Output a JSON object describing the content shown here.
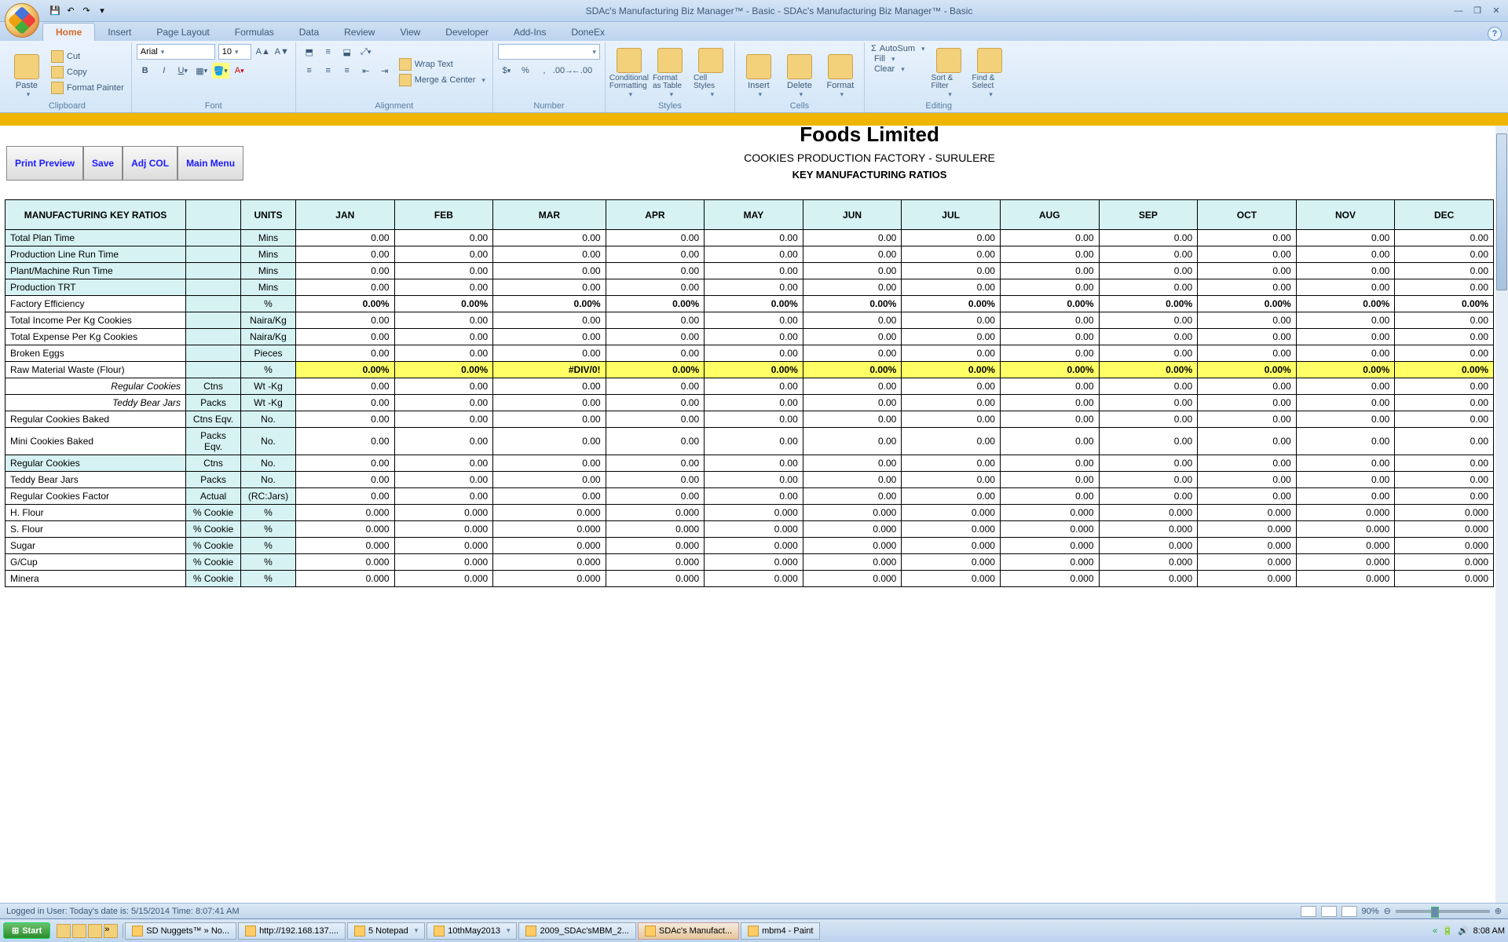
{
  "title": "SDAc's Manufacturing Biz Manager™ - Basic - SDAc's Manufacturing Biz Manager™ - Basic",
  "ribbon_tabs": [
    "Home",
    "Insert",
    "Page Layout",
    "Formulas",
    "Data",
    "Review",
    "View",
    "Developer",
    "Add-Ins",
    "DoneEx"
  ],
  "clipboard": {
    "paste": "Paste",
    "cut": "Cut",
    "copy": "Copy",
    "fp": "Format Painter",
    "label": "Clipboard"
  },
  "font": {
    "name": "Arial",
    "size": "10",
    "label": "Font"
  },
  "alignment": {
    "wrap": "Wrap Text",
    "merge": "Merge & Center",
    "label": "Alignment"
  },
  "number": {
    "label": "Number"
  },
  "styles": {
    "cond": "Conditional Formatting",
    "fat": "Format as Table",
    "cells": "Cell Styles",
    "label": "Styles"
  },
  "cells": {
    "insert": "Insert",
    "delete": "Delete",
    "format": "Format",
    "label": "Cells"
  },
  "editing": {
    "sum": "AutoSum",
    "fill": "Fill",
    "clear": "Clear",
    "sort": "Sort & Filter",
    "find": "Find & Select",
    "label": "Editing"
  },
  "doc_btns": [
    "Print Preview",
    "Save",
    "Adj COL",
    "Main Menu"
  ],
  "company": "Foods Limited",
  "factory": "COOKIES PRODUCTION FACTORY - SURULERE",
  "report": "KEY MANUFACTURING RATIOS",
  "headers": [
    "MANUFACTURING KEY RATIOS",
    "",
    "UNITS",
    "JAN",
    "FEB",
    "MAR",
    "APR",
    "MAY",
    "JUN",
    "JUL",
    "AUG",
    "SEP",
    "OCT",
    "NOV",
    "DEC"
  ],
  "rows": [
    {
      "label": "Total Plan Time",
      "c2": "",
      "u": "Mins",
      "vals": [
        "0.00",
        "0.00",
        "0.00",
        "0.00",
        "0.00",
        "0.00",
        "0.00",
        "0.00",
        "0.00",
        "0.00",
        "0.00",
        "0.00"
      ],
      "cls": "lbl"
    },
    {
      "label": "Production Line Run Time",
      "c2": "",
      "u": "Mins",
      "vals": [
        "0.00",
        "0.00",
        "0.00",
        "0.00",
        "0.00",
        "0.00",
        "0.00",
        "0.00",
        "0.00",
        "0.00",
        "0.00",
        "0.00"
      ],
      "cls": "lbl"
    },
    {
      "label": "Plant/Machine Run Time",
      "c2": "",
      "u": "Mins",
      "vals": [
        "0.00",
        "0.00",
        "0.00",
        "0.00",
        "0.00",
        "0.00",
        "0.00",
        "0.00",
        "0.00",
        "0.00",
        "0.00",
        "0.00"
      ],
      "cls": "lbl"
    },
    {
      "label": "Production TRT",
      "c2": "",
      "u": "Mins",
      "vals": [
        "0.00",
        "0.00",
        "0.00",
        "0.00",
        "0.00",
        "0.00",
        "0.00",
        "0.00",
        "0.00",
        "0.00",
        "0.00",
        "0.00"
      ],
      "cls": "lbl"
    },
    {
      "label": "Factory Efficiency",
      "c2": "",
      "u": "%",
      "vals": [
        "0.00%",
        "0.00%",
        "0.00%",
        "0.00%",
        "0.00%",
        "0.00%",
        "0.00%",
        "0.00%",
        "0.00%",
        "0.00%",
        "0.00%",
        "0.00%"
      ],
      "cls": "lbl-plain",
      "rowcls": "bold"
    },
    {
      "label": "Total Income Per Kg Cookies",
      "c2": "",
      "u": "Naira/Kg",
      "vals": [
        "0.00",
        "0.00",
        "0.00",
        "0.00",
        "0.00",
        "0.00",
        "0.00",
        "0.00",
        "0.00",
        "0.00",
        "0.00",
        "0.00"
      ],
      "cls": "lbl-plain"
    },
    {
      "label": "Total Expense Per Kg Cookies",
      "c2": "",
      "u": "Naira/Kg",
      "vals": [
        "0.00",
        "0.00",
        "0.00",
        "0.00",
        "0.00",
        "0.00",
        "0.00",
        "0.00",
        "0.00",
        "0.00",
        "0.00",
        "0.00"
      ],
      "cls": "lbl-plain"
    },
    {
      "label": "Broken Eggs",
      "c2": "",
      "u": "Pieces",
      "vals": [
        "0.00",
        "0.00",
        "0.00",
        "0.00",
        "0.00",
        "0.00",
        "0.00",
        "0.00",
        "0.00",
        "0.00",
        "0.00",
        "0.00"
      ],
      "cls": "lbl-plain"
    },
    {
      "label": "Raw Material Waste (Flour)",
      "c2": "",
      "u": "%",
      "vals": [
        "0.00%",
        "0.00%",
        "#DIV/0!",
        "0.00%",
        "0.00%",
        "0.00%",
        "0.00%",
        "0.00%",
        "0.00%",
        "0.00%",
        "0.00%",
        "0.00%"
      ],
      "cls": "lbl-plain",
      "rowcls": "yellow"
    },
    {
      "label": "Regular Cookies",
      "c2": "Ctns",
      "u": "Wt -Kg",
      "vals": [
        "0.00",
        "0.00",
        "0.00",
        "0.00",
        "0.00",
        "0.00",
        "0.00",
        "0.00",
        "0.00",
        "0.00",
        "0.00",
        "0.00"
      ],
      "cls": "lbl-right"
    },
    {
      "label": "Teddy Bear Jars",
      "c2": "Packs",
      "u": "Wt -Kg",
      "vals": [
        "0.00",
        "0.00",
        "0.00",
        "0.00",
        "0.00",
        "0.00",
        "0.00",
        "0.00",
        "0.00",
        "0.00",
        "0.00",
        "0.00"
      ],
      "cls": "lbl-right"
    },
    {
      "label": "Regular Cookies Baked",
      "c2": "Ctns Eqv.",
      "u": "No.",
      "vals": [
        "0.00",
        "0.00",
        "0.00",
        "0.00",
        "0.00",
        "0.00",
        "0.00",
        "0.00",
        "0.00",
        "0.00",
        "0.00",
        "0.00"
      ],
      "cls": "lbl-plain"
    },
    {
      "label": "Mini Cookies Baked",
      "c2": "Packs Eqv.",
      "u": "No.",
      "vals": [
        "0.00",
        "0.00",
        "0.00",
        "0.00",
        "0.00",
        "0.00",
        "0.00",
        "0.00",
        "0.00",
        "0.00",
        "0.00",
        "0.00"
      ],
      "cls": "lbl-plain"
    },
    {
      "label": "Regular Cookies",
      "c2": "Ctns",
      "u": "No.",
      "vals": [
        "0.00",
        "0.00",
        "0.00",
        "0.00",
        "0.00",
        "0.00",
        "0.00",
        "0.00",
        "0.00",
        "0.00",
        "0.00",
        "0.00"
      ],
      "cls": "lbl"
    },
    {
      "label": "Teddy Bear Jars",
      "c2": "Packs",
      "u": "No.",
      "vals": [
        "0.00",
        "0.00",
        "0.00",
        "0.00",
        "0.00",
        "0.00",
        "0.00",
        "0.00",
        "0.00",
        "0.00",
        "0.00",
        "0.00"
      ],
      "cls": "lbl-plain"
    },
    {
      "label": "Regular Cookies Factor",
      "c2": "Actual",
      "u": "(RC:Jars)",
      "vals": [
        "0.00",
        "0.00",
        "0.00",
        "0.00",
        "0.00",
        "0.00",
        "0.00",
        "0.00",
        "0.00",
        "0.00",
        "0.00",
        "0.00"
      ],
      "cls": "lbl-plain"
    },
    {
      "label": "H. Flour",
      "c2": "% Cookie",
      "u": "%",
      "vals": [
        "0.000",
        "0.000",
        "0.000",
        "0.000",
        "0.000",
        "0.000",
        "0.000",
        "0.000",
        "0.000",
        "0.000",
        "0.000",
        "0.000"
      ],
      "cls": "lbl-plain"
    },
    {
      "label": "S. Flour",
      "c2": "% Cookie",
      "u": "%",
      "vals": [
        "0.000",
        "0.000",
        "0.000",
        "0.000",
        "0.000",
        "0.000",
        "0.000",
        "0.000",
        "0.000",
        "0.000",
        "0.000",
        "0.000"
      ],
      "cls": "lbl-plain"
    },
    {
      "label": "Sugar",
      "c2": "% Cookie",
      "u": "%",
      "vals": [
        "0.000",
        "0.000",
        "0.000",
        "0.000",
        "0.000",
        "0.000",
        "0.000",
        "0.000",
        "0.000",
        "0.000",
        "0.000",
        "0.000"
      ],
      "cls": "lbl-plain"
    },
    {
      "label": "G/Cup",
      "c2": "% Cookie",
      "u": "%",
      "vals": [
        "0.000",
        "0.000",
        "0.000",
        "0.000",
        "0.000",
        "0.000",
        "0.000",
        "0.000",
        "0.000",
        "0.000",
        "0.000",
        "0.000"
      ],
      "cls": "lbl-plain"
    },
    {
      "label": "Minera",
      "c2": "% Cookie",
      "u": "%",
      "vals": [
        "0.000",
        "0.000",
        "0.000",
        "0.000",
        "0.000",
        "0.000",
        "0.000",
        "0.000",
        "0.000",
        "0.000",
        "0.000",
        "0.000"
      ],
      "cls": "lbl-plain"
    }
  ],
  "status": "Logged in User:  Today's date is: 5/15/2014 Time: 8:07:41 AM",
  "zoom": "90%",
  "taskbar": {
    "start": "Start",
    "tasks": [
      "SD Nuggets™ » No...",
      "http://192.168.137....",
      "5 Notepad",
      "10thMay2013",
      "2009_SDAc'sMBM_2...",
      "SDAc's Manufact...",
      "mbm4 - Paint"
    ],
    "time": "8:08 AM"
  }
}
